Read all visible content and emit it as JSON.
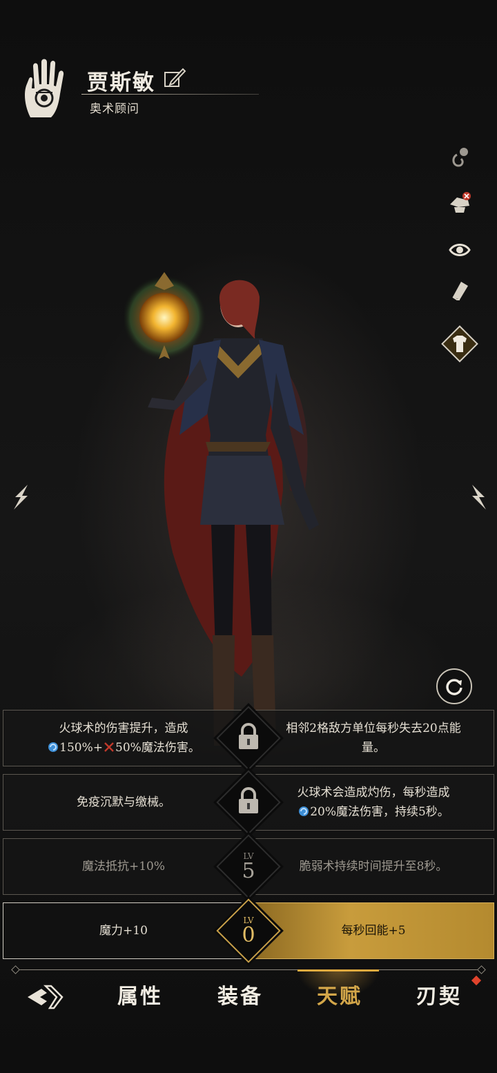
{
  "header": {
    "character_name": "贾斯敏",
    "character_title": "奥术顾问"
  },
  "side_tools": [
    "hook-icon",
    "hide-helmet-icon",
    "eye-icon",
    "book-icon",
    "outfit-icon"
  ],
  "talents": [
    {
      "left": "火球术的伤害提升，造成",
      "left_line2_a": "150%+",
      "left_line2_b": "50%魔法伤害。",
      "right": "相邻2格敌方单位每秒失去20点能",
      "right_line2": "量。",
      "node": "locked"
    },
    {
      "left": "免疫沉默与缴械。",
      "right": "火球术会造成灼伤，每秒造成",
      "right_line2": "20%魔法伤害，持续5秒。",
      "node": "locked"
    },
    {
      "left": "魔法抵抗+10%",
      "right": "脆弱术持续时间提升至8秒。",
      "lv_label": "LV",
      "lv_value": "5"
    },
    {
      "left": "魔力+10",
      "right": "每秒回能+5",
      "lv_label": "LV",
      "lv_value": "0"
    }
  ],
  "bottom_nav": {
    "tabs": [
      "属性",
      "装备",
      "天赋",
      "刃契"
    ],
    "active": "天赋"
  },
  "colors": {
    "accent_gold": "#d3a649",
    "notify_red": "#e0432c",
    "magic_blue": "#3e8fd6",
    "physical_red": "#c0392b"
  }
}
